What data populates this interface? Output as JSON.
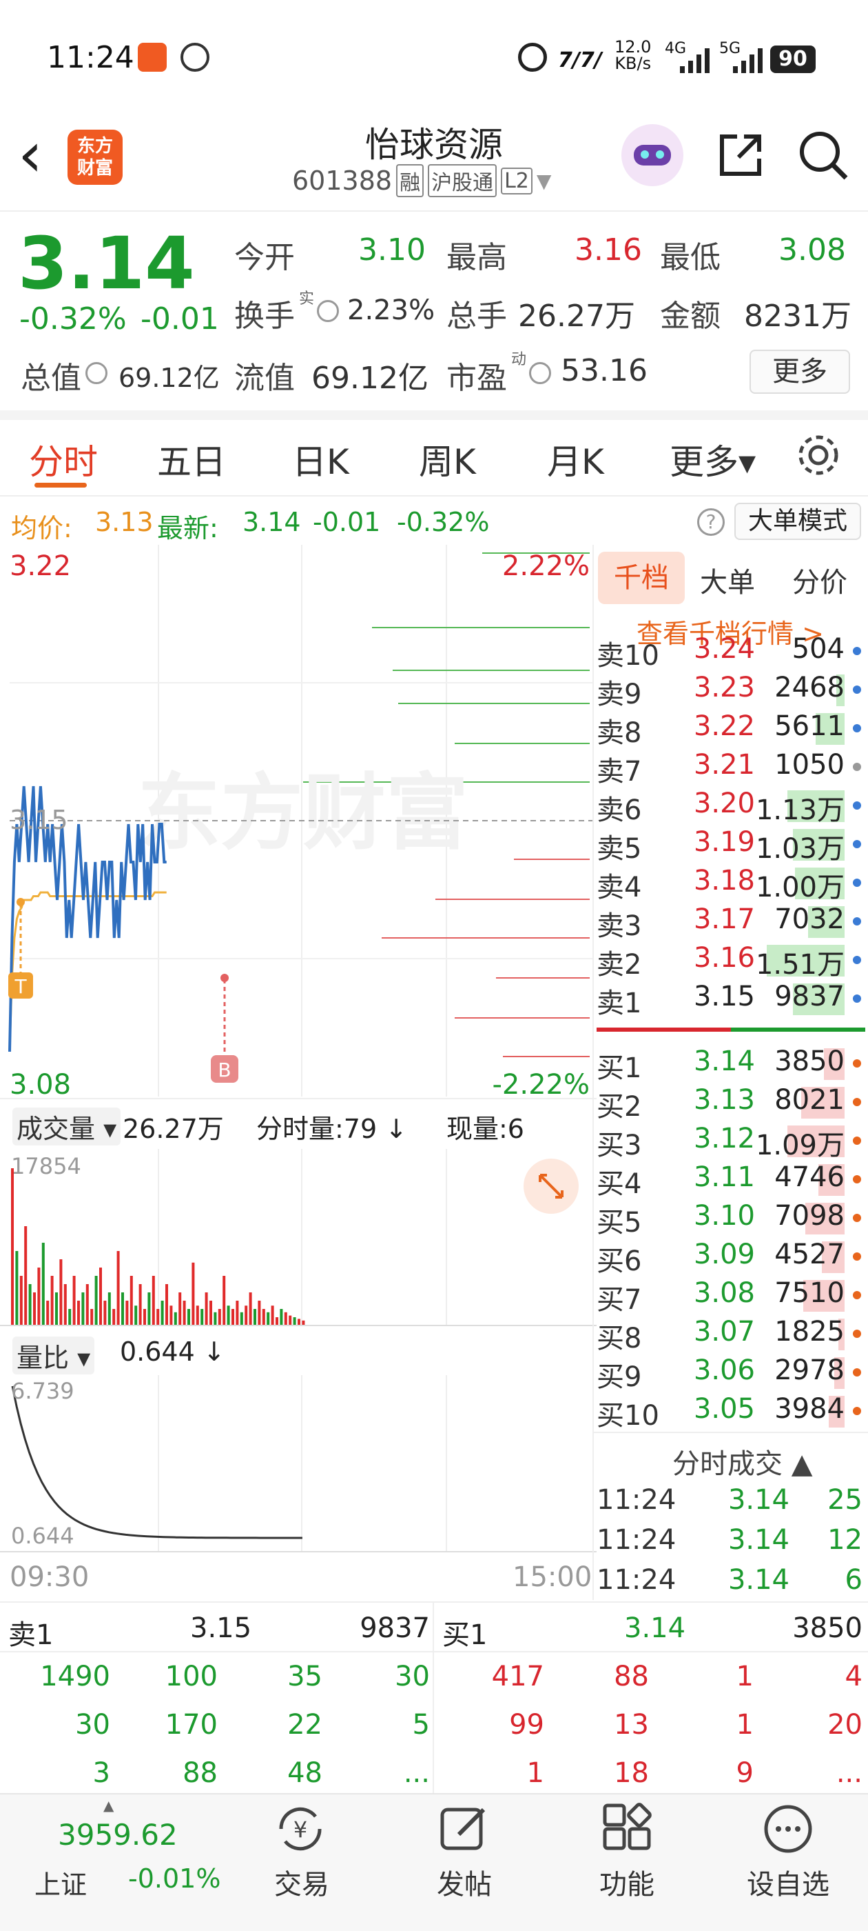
{
  "status": {
    "time": "11:24",
    "speed": "12.0",
    "speed_unit": "KB/s",
    "net1": "4G",
    "net2": "5G",
    "battery": "90"
  },
  "header": {
    "back": "‹",
    "logo_line1": "东方",
    "logo_line2": "财富",
    "title": "怡球资源",
    "code": "601388",
    "tags": [
      "融",
      "沪股通",
      "L2"
    ]
  },
  "quote": {
    "price": "3.14",
    "pct": "-0.32%",
    "chg": "-0.01",
    "fields": [
      {
        "label": "今开",
        "value": "3.10"
      },
      {
        "label": "最高",
        "value": "3.16"
      },
      {
        "label": "最低",
        "value": "3.08"
      },
      {
        "label": "换手",
        "value": "2.23%",
        "sup": "实"
      },
      {
        "label": "总手",
        "value": "26.27万"
      },
      {
        "label": "金额",
        "value": "8231万"
      },
      {
        "label": "总值",
        "value": "69.12亿"
      },
      {
        "label": "流值",
        "value": "69.12亿"
      },
      {
        "label": "市盈",
        "value": "53.16",
        "sup": "动"
      }
    ],
    "more": "更多"
  },
  "tabs": [
    "分时",
    "五日",
    "日K",
    "周K",
    "月K",
    "更多▾"
  ],
  "infoline": {
    "avg_label": "均价:",
    "avg": "3.13",
    "new_label": "最新:",
    "new": "3.14",
    "chg": "-0.01",
    "pct": "-0.32%",
    "mode_btn": "大单模式"
  },
  "chart": {
    "y_max": "3.22",
    "y_min": "3.08",
    "pct_max": "2.22%",
    "pct_min": "-2.22%",
    "prev_close": "3.15",
    "watermark": "东方财富",
    "marker_t": "T",
    "marker_b": "B"
  },
  "volume": {
    "label": "成交量",
    "total": "26.27万",
    "tick_label": "分时量:79 ↓",
    "cur_label": "现量:6",
    "max": "17854"
  },
  "ratio": {
    "label": "量比",
    "value": "0.644 ↓",
    "max": "6.739",
    "min": "0.644",
    "t_start": "09:30",
    "t_end": "15:00"
  },
  "orderbook": {
    "tabs": [
      "千档",
      "大单",
      "分价"
    ],
    "link": "查看千档行情 >",
    "sells": [
      {
        "l": "卖10",
        "p": "3.24",
        "v": "504",
        "bar": 0.0,
        "dot": "#3a7bd5"
      },
      {
        "l": "卖9",
        "p": "3.23",
        "v": "2468",
        "bar": 0.08,
        "dot": "#3a7bd5"
      },
      {
        "l": "卖8",
        "p": "3.22",
        "v": "5611",
        "bar": 0.28,
        "dot": "#3a7bd5"
      },
      {
        "l": "卖7",
        "p": "3.21",
        "v": "1050",
        "bar": 0.0,
        "dot": "#999999"
      },
      {
        "l": "卖6",
        "p": "3.20",
        "v": "1.13万",
        "bar": 0.55,
        "dot": "#3a7bd5"
      },
      {
        "l": "卖5",
        "p": "3.19",
        "v": "1.03万",
        "bar": 0.5,
        "dot": "#3a7bd5"
      },
      {
        "l": "卖4",
        "p": "3.18",
        "v": "1.00万",
        "bar": 0.48,
        "dot": "#3a7bd5"
      },
      {
        "l": "卖3",
        "p": "3.17",
        "v": "7032",
        "bar": 0.35,
        "dot": "#3a7bd5"
      },
      {
        "l": "卖2",
        "p": "3.16",
        "v": "1.51万",
        "bar": 0.75,
        "dot": "#3a7bd5"
      },
      {
        "l": "卖1",
        "p": "3.15",
        "v": "9837",
        "bar": 0.5,
        "dot": "#3a7bd5"
      }
    ],
    "buys": [
      {
        "l": "买1",
        "p": "3.14",
        "v": "3850",
        "bar": 0.2,
        "dot": "#e8651c"
      },
      {
        "l": "买2",
        "p": "3.13",
        "v": "8021",
        "bar": 0.42,
        "dot": "#e8651c"
      },
      {
        "l": "买3",
        "p": "3.12",
        "v": "1.09万",
        "bar": 0.55,
        "dot": "#e8651c"
      },
      {
        "l": "买4",
        "p": "3.11",
        "v": "4746",
        "bar": 0.25,
        "dot": "#e8651c"
      },
      {
        "l": "买5",
        "p": "3.10",
        "v": "7098",
        "bar": 0.38,
        "dot": "#e8651c"
      },
      {
        "l": "买6",
        "p": "3.09",
        "v": "4527",
        "bar": 0.22,
        "dot": "#e8651c"
      },
      {
        "l": "买7",
        "p": "3.08",
        "v": "7510",
        "bar": 0.4,
        "dot": "#e8651c"
      },
      {
        "l": "买8",
        "p": "3.07",
        "v": "1825",
        "bar": 0.06,
        "dot": "#e8651c"
      },
      {
        "l": "买9",
        "p": "3.06",
        "v": "2978",
        "bar": 0.1,
        "dot": "#e8651c"
      },
      {
        "l": "买10",
        "p": "3.05",
        "v": "3984",
        "bar": 0.15,
        "dot": "#e8651c"
      }
    ],
    "ticks_title": "分时成交 ▲",
    "ticks": [
      {
        "t": "11:24",
        "p": "3.14",
        "v": "25"
      },
      {
        "t": "11:24",
        "p": "3.14",
        "v": "12"
      },
      {
        "t": "11:24",
        "p": "3.14",
        "v": "6"
      }
    ]
  },
  "queue": {
    "sell_label": "卖1",
    "sell_price": "3.15",
    "sell_vol": "9837",
    "buy_label": "买1",
    "buy_price": "3.14",
    "buy_vol": "3850",
    "sell_rows": [
      [
        "1490",
        "100",
        "35",
        "30"
      ],
      [
        "30",
        "170",
        "22",
        "5"
      ],
      [
        "3",
        "88",
        "48",
        "..."
      ]
    ],
    "buy_rows": [
      [
        "417",
        "88",
        "1",
        "4"
      ],
      [
        "99",
        "13",
        "1",
        "20"
      ],
      [
        "1",
        "18",
        "9",
        "..."
      ]
    ]
  },
  "bottom": {
    "index_value": "3959.62",
    "index_name": "上证",
    "index_pct": "-0.01%",
    "nav": [
      "交易",
      "发帖",
      "功能",
      "设自选"
    ]
  },
  "chart_data": {
    "type": "line",
    "title": "",
    "x_start": "09:30",
    "x_end": "15:00",
    "ylim": [
      3.08,
      3.22
    ],
    "prev_close": 3.15,
    "series": [
      {
        "values": [
          3.09,
          3.12,
          3.14,
          3.15,
          3.14,
          3.15,
          3.16,
          3.15,
          3.14,
          3.15,
          3.16,
          3.14,
          3.15,
          3.16,
          3.15,
          3.14,
          3.15,
          3.14,
          3.15,
          3.14,
          3.13,
          3.14,
          3.15,
          3.14,
          3.12,
          3.13,
          3.12,
          3.13,
          3.14,
          3.15,
          3.14,
          3.13,
          3.14,
          3.13,
          3.12,
          3.13,
          3.14,
          3.12,
          3.13,
          3.14,
          3.14,
          3.13,
          3.14,
          3.14,
          3.12,
          3.13,
          3.12,
          3.14,
          3.13,
          3.14,
          3.15,
          3.14,
          3.14,
          3.13,
          3.15,
          3.14,
          3.15,
          3.13,
          3.14,
          3.13,
          3.15,
          3.14,
          3.14,
          3.15,
          3.15,
          3.14,
          3.14
        ]
      },
      {
        "values": [
          3.09,
          3.11,
          3.12,
          3.125,
          3.127,
          3.128,
          3.13,
          3.13,
          3.13,
          3.13,
          3.131,
          3.131,
          3.131,
          3.132,
          3.132,
          3.132,
          3.132,
          3.131,
          3.131,
          3.131,
          3.131,
          3.131,
          3.131,
          3.131,
          3.131,
          3.131,
          3.131,
          3.131,
          3.131,
          3.131,
          3.131,
          3.131,
          3.131,
          3.131,
          3.131,
          3.131,
          3.131,
          3.131,
          3.131,
          3.131,
          3.131,
          3.131,
          3.131,
          3.131,
          3.131,
          3.131,
          3.131,
          3.131,
          3.131,
          3.131,
          3.131,
          3.131,
          3.131,
          3.131,
          3.131,
          3.131,
          3.131,
          3.131,
          3.131,
          3.131,
          3.131,
          3.132,
          3.132,
          3.132,
          3.132,
          3.132,
          3.132
        ]
      }
    ],
    "volume_max": 17854,
    "ratio_range": [
      0.644,
      6.739
    ]
  }
}
